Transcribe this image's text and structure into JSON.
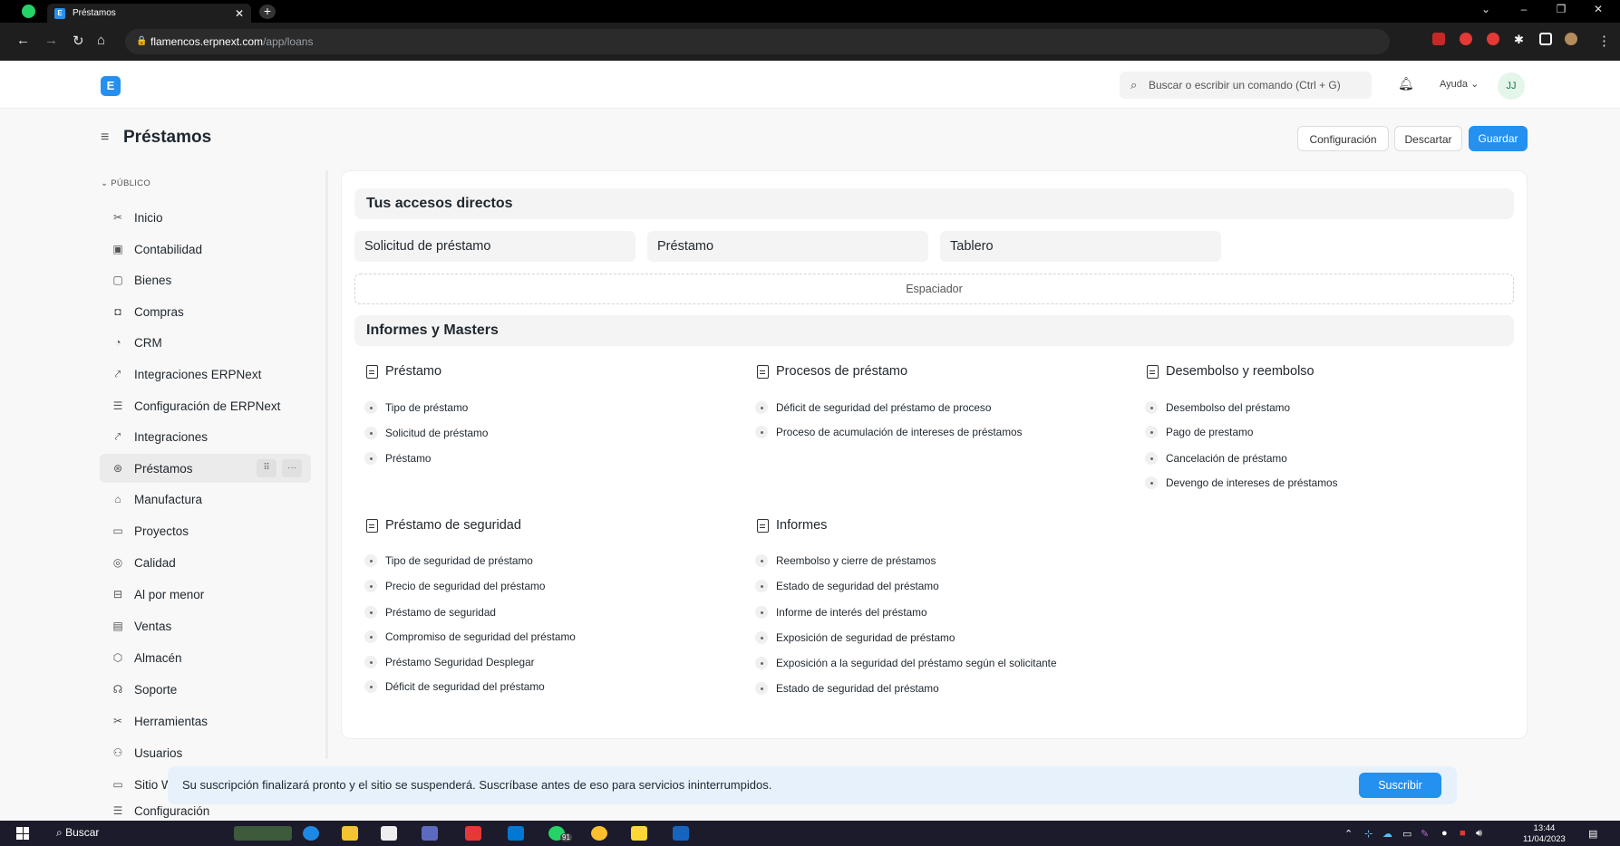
{
  "browser": {
    "tab_title": "Préstamos",
    "url_host": "flamencos.erpnext.com",
    "url_path": "/app/loans"
  },
  "navbar": {
    "logo_letter": "E",
    "search_placeholder": "Buscar o escribir un comando (Ctrl + G)",
    "help_label": "Ayuda",
    "avatar_initials": "JJ"
  },
  "page": {
    "title": "Préstamos",
    "buttons": {
      "config": "Configuración",
      "discard": "Descartar",
      "save": "Guardar"
    }
  },
  "sidebar": {
    "section": "PÚBLICO",
    "items": [
      {
        "label": "Inicio",
        "icon": "tools-icon"
      },
      {
        "label": "Contabilidad",
        "icon": "accounting-icon"
      },
      {
        "label": "Bienes",
        "icon": "assets-icon"
      },
      {
        "label": "Compras",
        "icon": "buying-icon"
      },
      {
        "label": "CRM",
        "icon": "crm-icon"
      },
      {
        "label": "Integraciones ERPNext",
        "icon": "integration-icon"
      },
      {
        "label": "Configuración de ERPNext",
        "icon": "settings-icon"
      },
      {
        "label": "Integraciones",
        "icon": "integration-icon"
      },
      {
        "label": "Préstamos",
        "icon": "loan-icon"
      },
      {
        "label": "Manufactura",
        "icon": "factory-icon"
      },
      {
        "label": "Proyectos",
        "icon": "folder-icon"
      },
      {
        "label": "Calidad",
        "icon": "quality-icon"
      },
      {
        "label": "Al por menor",
        "icon": "retail-icon"
      },
      {
        "label": "Ventas",
        "icon": "sales-icon"
      },
      {
        "label": "Almacén",
        "icon": "stock-icon"
      },
      {
        "label": "Soporte",
        "icon": "support-icon"
      },
      {
        "label": "Herramientas",
        "icon": "tools-icon"
      },
      {
        "label": "Usuarios",
        "icon": "users-icon"
      },
      {
        "label": "Sitio W",
        "icon": "website-icon"
      },
      {
        "label": "Configuración",
        "icon": "settings-icon"
      }
    ]
  },
  "shortcuts": {
    "heading": "Tus accesos directos",
    "items": [
      "Solicitud de préstamo",
      "Préstamo",
      "Tablero"
    ],
    "spacer": "Espaciador"
  },
  "reports": {
    "heading": "Informes y Masters",
    "groups": [
      {
        "title": "Préstamo",
        "links": [
          "Tipo de préstamo",
          "Solicitud de préstamo",
          "Préstamo"
        ]
      },
      {
        "title": "Procesos de préstamo",
        "links": [
          "Déficit de seguridad del préstamo de proceso",
          "Proceso de acumulación de intereses de préstamos"
        ]
      },
      {
        "title": "Desembolso y reembolso",
        "links": [
          "Desembolso del préstamo",
          "Pago de prestamo",
          "Cancelación de préstamo",
          "Devengo de intereses de préstamos"
        ]
      },
      {
        "title": "Préstamo de seguridad",
        "links": [
          "Tipo de seguridad de préstamo",
          "Precio de seguridad del préstamo",
          "Préstamo de seguridad",
          "Compromiso de seguridad del préstamo",
          "Préstamo Seguridad Desplegar",
          "Déficit de seguridad del préstamo"
        ]
      },
      {
        "title": "Informes",
        "links": [
          "Reembolso y cierre de préstamos",
          "Estado de seguridad del préstamo",
          "Informe de interés del préstamo",
          "Exposición de seguridad de préstamo",
          "Exposición a la seguridad del préstamo según el solicitante",
          "Estado de seguridad del préstamo"
        ]
      }
    ]
  },
  "banner": {
    "text": "Su suscripción finalizará pronto y el sitio se suspenderá. Suscríbase antes de eso para servicios ininterrumpidos.",
    "button": "Suscribir"
  },
  "taskbar": {
    "search": "Buscar",
    "time": "13:44",
    "date": "11/04/2023",
    "whatsapp_badge": "91"
  }
}
